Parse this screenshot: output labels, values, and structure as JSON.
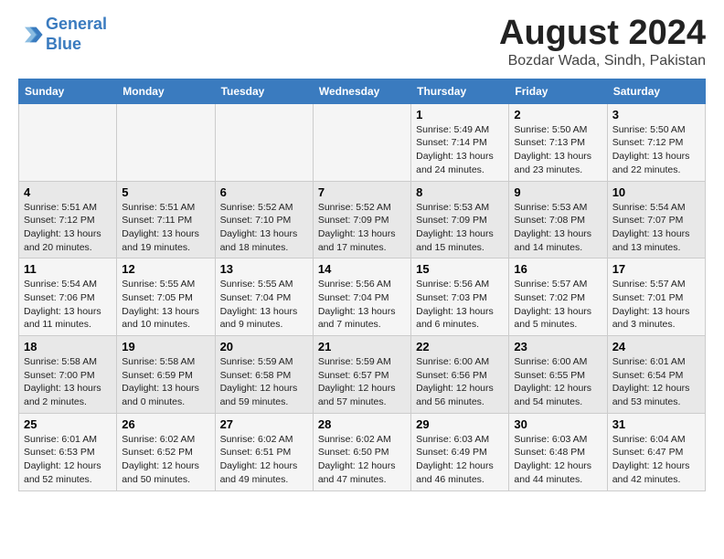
{
  "header": {
    "logo_line1": "General",
    "logo_line2": "Blue",
    "month_year": "August 2024",
    "location": "Bozdar Wada, Sindh, Pakistan"
  },
  "days_of_week": [
    "Sunday",
    "Monday",
    "Tuesday",
    "Wednesday",
    "Thursday",
    "Friday",
    "Saturday"
  ],
  "weeks": [
    [
      {
        "day": "",
        "info": ""
      },
      {
        "day": "",
        "info": ""
      },
      {
        "day": "",
        "info": ""
      },
      {
        "day": "",
        "info": ""
      },
      {
        "day": "1",
        "info": "Sunrise: 5:49 AM\nSunset: 7:14 PM\nDaylight: 13 hours\nand 24 minutes."
      },
      {
        "day": "2",
        "info": "Sunrise: 5:50 AM\nSunset: 7:13 PM\nDaylight: 13 hours\nand 23 minutes."
      },
      {
        "day": "3",
        "info": "Sunrise: 5:50 AM\nSunset: 7:12 PM\nDaylight: 13 hours\nand 22 minutes."
      }
    ],
    [
      {
        "day": "4",
        "info": "Sunrise: 5:51 AM\nSunset: 7:12 PM\nDaylight: 13 hours\nand 20 minutes."
      },
      {
        "day": "5",
        "info": "Sunrise: 5:51 AM\nSunset: 7:11 PM\nDaylight: 13 hours\nand 19 minutes."
      },
      {
        "day": "6",
        "info": "Sunrise: 5:52 AM\nSunset: 7:10 PM\nDaylight: 13 hours\nand 18 minutes."
      },
      {
        "day": "7",
        "info": "Sunrise: 5:52 AM\nSunset: 7:09 PM\nDaylight: 13 hours\nand 17 minutes."
      },
      {
        "day": "8",
        "info": "Sunrise: 5:53 AM\nSunset: 7:09 PM\nDaylight: 13 hours\nand 15 minutes."
      },
      {
        "day": "9",
        "info": "Sunrise: 5:53 AM\nSunset: 7:08 PM\nDaylight: 13 hours\nand 14 minutes."
      },
      {
        "day": "10",
        "info": "Sunrise: 5:54 AM\nSunset: 7:07 PM\nDaylight: 13 hours\nand 13 minutes."
      }
    ],
    [
      {
        "day": "11",
        "info": "Sunrise: 5:54 AM\nSunset: 7:06 PM\nDaylight: 13 hours\nand 11 minutes."
      },
      {
        "day": "12",
        "info": "Sunrise: 5:55 AM\nSunset: 7:05 PM\nDaylight: 13 hours\nand 10 minutes."
      },
      {
        "day": "13",
        "info": "Sunrise: 5:55 AM\nSunset: 7:04 PM\nDaylight: 13 hours\nand 9 minutes."
      },
      {
        "day": "14",
        "info": "Sunrise: 5:56 AM\nSunset: 7:04 PM\nDaylight: 13 hours\nand 7 minutes."
      },
      {
        "day": "15",
        "info": "Sunrise: 5:56 AM\nSunset: 7:03 PM\nDaylight: 13 hours\nand 6 minutes."
      },
      {
        "day": "16",
        "info": "Sunrise: 5:57 AM\nSunset: 7:02 PM\nDaylight: 13 hours\nand 5 minutes."
      },
      {
        "day": "17",
        "info": "Sunrise: 5:57 AM\nSunset: 7:01 PM\nDaylight: 13 hours\nand 3 minutes."
      }
    ],
    [
      {
        "day": "18",
        "info": "Sunrise: 5:58 AM\nSunset: 7:00 PM\nDaylight: 13 hours\nand 2 minutes."
      },
      {
        "day": "19",
        "info": "Sunrise: 5:58 AM\nSunset: 6:59 PM\nDaylight: 13 hours\nand 0 minutes."
      },
      {
        "day": "20",
        "info": "Sunrise: 5:59 AM\nSunset: 6:58 PM\nDaylight: 12 hours\nand 59 minutes."
      },
      {
        "day": "21",
        "info": "Sunrise: 5:59 AM\nSunset: 6:57 PM\nDaylight: 12 hours\nand 57 minutes."
      },
      {
        "day": "22",
        "info": "Sunrise: 6:00 AM\nSunset: 6:56 PM\nDaylight: 12 hours\nand 56 minutes."
      },
      {
        "day": "23",
        "info": "Sunrise: 6:00 AM\nSunset: 6:55 PM\nDaylight: 12 hours\nand 54 minutes."
      },
      {
        "day": "24",
        "info": "Sunrise: 6:01 AM\nSunset: 6:54 PM\nDaylight: 12 hours\nand 53 minutes."
      }
    ],
    [
      {
        "day": "25",
        "info": "Sunrise: 6:01 AM\nSunset: 6:53 PM\nDaylight: 12 hours\nand 52 minutes."
      },
      {
        "day": "26",
        "info": "Sunrise: 6:02 AM\nSunset: 6:52 PM\nDaylight: 12 hours\nand 50 minutes."
      },
      {
        "day": "27",
        "info": "Sunrise: 6:02 AM\nSunset: 6:51 PM\nDaylight: 12 hours\nand 49 minutes."
      },
      {
        "day": "28",
        "info": "Sunrise: 6:02 AM\nSunset: 6:50 PM\nDaylight: 12 hours\nand 47 minutes."
      },
      {
        "day": "29",
        "info": "Sunrise: 6:03 AM\nSunset: 6:49 PM\nDaylight: 12 hours\nand 46 minutes."
      },
      {
        "day": "30",
        "info": "Sunrise: 6:03 AM\nSunset: 6:48 PM\nDaylight: 12 hours\nand 44 minutes."
      },
      {
        "day": "31",
        "info": "Sunrise: 6:04 AM\nSunset: 6:47 PM\nDaylight: 12 hours\nand 42 minutes."
      }
    ]
  ]
}
